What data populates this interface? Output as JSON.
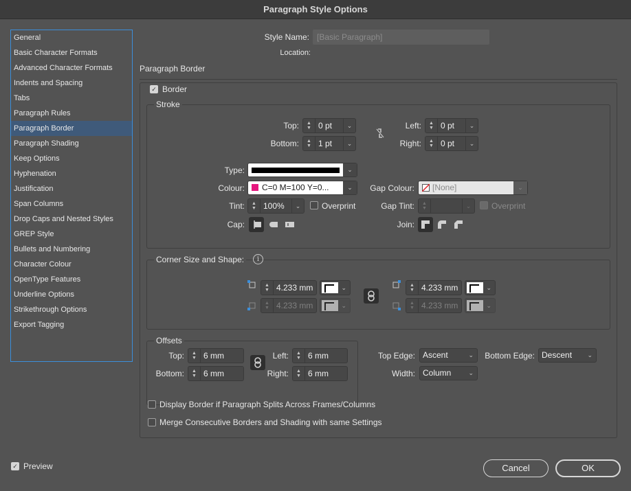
{
  "window": {
    "title": "Paragraph Style Options"
  },
  "sidebar": {
    "items": [
      {
        "label": "General"
      },
      {
        "label": "Basic Character Formats"
      },
      {
        "label": "Advanced Character Formats"
      },
      {
        "label": "Indents and Spacing"
      },
      {
        "label": "Tabs"
      },
      {
        "label": "Paragraph Rules"
      },
      {
        "label": "Paragraph Border",
        "selected": true
      },
      {
        "label": "Paragraph Shading"
      },
      {
        "label": "Keep Options"
      },
      {
        "label": "Hyphenation"
      },
      {
        "label": "Justification"
      },
      {
        "label": "Span Columns"
      },
      {
        "label": "Drop Caps and Nested Styles"
      },
      {
        "label": "GREP Style"
      },
      {
        "label": "Bullets and Numbering"
      },
      {
        "label": "Character Colour"
      },
      {
        "label": "OpenType Features"
      },
      {
        "label": "Underline Options"
      },
      {
        "label": "Strikethrough Options"
      },
      {
        "label": "Export Tagging"
      }
    ]
  },
  "header": {
    "style_name_label": "Style Name:",
    "style_name_value": "[Basic Paragraph]",
    "location_label": "Location:",
    "location_value": ""
  },
  "section": {
    "title": "Paragraph Border"
  },
  "border": {
    "label": "Border",
    "checked": true
  },
  "stroke": {
    "title": "Stroke",
    "top_label": "Top:",
    "top_value": "0 pt",
    "bottom_label": "Bottom:",
    "bottom_value": "1 pt",
    "left_label": "Left:",
    "left_value": "0 pt",
    "right_label": "Right:",
    "right_value": "0 pt",
    "type_label": "Type:",
    "colour_label": "Colour:",
    "colour_value": "C=0 M=100 Y=0...",
    "colour_swatch": "#e5177e",
    "gap_colour_label": "Gap Colour:",
    "gap_colour_value": "[None]",
    "tint_label": "Tint:",
    "tint_value": "100%",
    "overprint_label": "Overprint",
    "gap_tint_label": "Gap Tint:",
    "gap_tint_value": "",
    "gap_overprint_label": "Overprint",
    "cap_label": "Cap:",
    "join_label": "Join:"
  },
  "corner": {
    "title": "Corner Size and Shape:",
    "top_left_value": "4.233 mm",
    "bottom_left_value": "4.233 mm",
    "top_right_value": "4.233 mm",
    "bottom_right_value": "4.233 mm"
  },
  "offsets": {
    "title": "Offsets",
    "top_label": "Top:",
    "top_value": "6 mm",
    "bottom_label": "Bottom:",
    "bottom_value": "6 mm",
    "left_label": "Left:",
    "left_value": "6 mm",
    "right_label": "Right:",
    "right_value": "6 mm",
    "top_edge_label": "Top Edge:",
    "top_edge_value": "Ascent",
    "bottom_edge_label": "Bottom Edge:",
    "bottom_edge_value": "Descent",
    "width_label": "Width:",
    "width_value": "Column"
  },
  "options": {
    "display_split_label": "Display Border if Paragraph Splits Across Frames/Columns",
    "merge_label": "Merge Consecutive Borders and Shading with same Settings"
  },
  "footer": {
    "preview_label": "Preview",
    "cancel_label": "Cancel",
    "ok_label": "OK"
  }
}
